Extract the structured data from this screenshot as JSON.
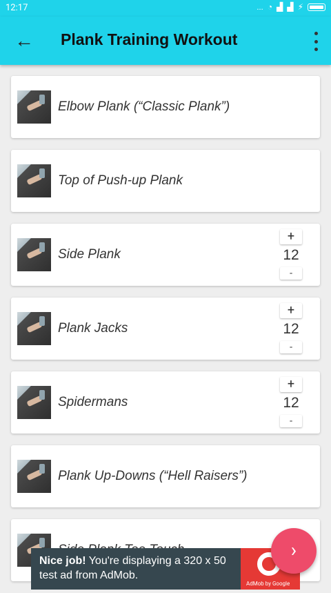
{
  "status_bar": {
    "time": "12:17",
    "signal_dots": "...",
    "charging": "⚡"
  },
  "app_bar": {
    "title": "Plank Training Workout"
  },
  "exercises": [
    {
      "name": "Elbow Plank (“Classic Plank”)",
      "count": null
    },
    {
      "name": "Top of Push-up Plank",
      "count": null
    },
    {
      "name": "Side Plank",
      "count": "12"
    },
    {
      "name": "Plank Jacks",
      "count": "12"
    },
    {
      "name": "Spidermans",
      "count": "12"
    },
    {
      "name": "Plank Up-Downs (“Hell Raisers”)",
      "count": null
    },
    {
      "name": "Side Plank Toe Touch",
      "count": null
    }
  ],
  "stepper": {
    "plus": "+",
    "minus": "-"
  },
  "ad": {
    "headline": "Nice job!",
    "body": " You're displaying a 320 x 50 test ad from AdMob.",
    "attribution": "AdMob by Google"
  },
  "fab": {
    "icon": "chevron-right-icon",
    "glyph": "›"
  },
  "colors": {
    "app_bar": "#1fd3ea",
    "fab": "#ee4b6a",
    "ad_bg": "#36474f",
    "ad_logo": "#e53935"
  }
}
